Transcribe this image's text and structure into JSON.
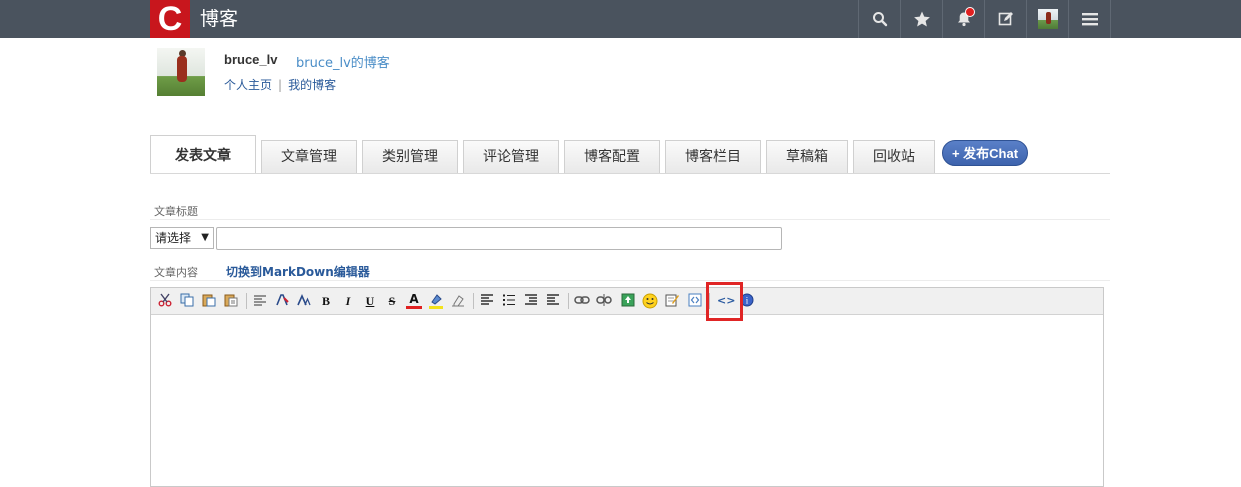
{
  "header": {
    "logo_letter": "C",
    "title": "博客",
    "icons": [
      "search-icon",
      "star-icon",
      "bell-icon",
      "edit-icon",
      "avatar",
      "menu-icon"
    ],
    "notification_dot_color": "#e02020"
  },
  "profile": {
    "username": "bruce_lv",
    "blog_name": "bruce_lv的博客",
    "links": [
      "个人主页",
      "我的博客"
    ],
    "separator": "|"
  },
  "tabs": [
    {
      "label": "发表文章",
      "active": true
    },
    {
      "label": "文章管理"
    },
    {
      "label": "类别管理"
    },
    {
      "label": "评论管理"
    },
    {
      "label": "博客配置"
    },
    {
      "label": "博客栏目"
    },
    {
      "label": "草稿箱"
    },
    {
      "label": "回收站"
    }
  ],
  "publish_chat": {
    "label": "+ 发布Chat",
    "color": "#3d63ad"
  },
  "form": {
    "title_label": "文章标题",
    "type_select": {
      "value": "请选择",
      "arrow": "▼"
    },
    "title_value": "",
    "content_label": "文章内容",
    "markdown_link": "切换到MarkDown编辑器"
  },
  "editor": {
    "toolbar_buttons": [
      "cut-icon",
      "copy-icon",
      "paste-icon",
      "paste-text-icon",
      "font-format-icon",
      "font-color-icon",
      "font-size-icon",
      "bold-icon",
      "italic-icon",
      "underline-icon",
      "strikethrough-icon",
      "text-color-icon",
      "background-color-icon",
      "clear-format-icon",
      "align-icon",
      "list-icon",
      "indent-icon",
      "outdent-icon",
      "link-icon",
      "unlink-icon",
      "image-upload-icon",
      "emoji-icon",
      "edit-html-icon",
      "insert-code-icon",
      "source-code-icon",
      "info-icon"
    ],
    "highlighted_button": "source-code-icon",
    "highlight_color": "#e02525",
    "glyphs": {
      "bold": "B",
      "italic": "I",
      "underline": "U",
      "strike": "S",
      "font": "A",
      "source": "<>",
      "info": "i"
    }
  }
}
